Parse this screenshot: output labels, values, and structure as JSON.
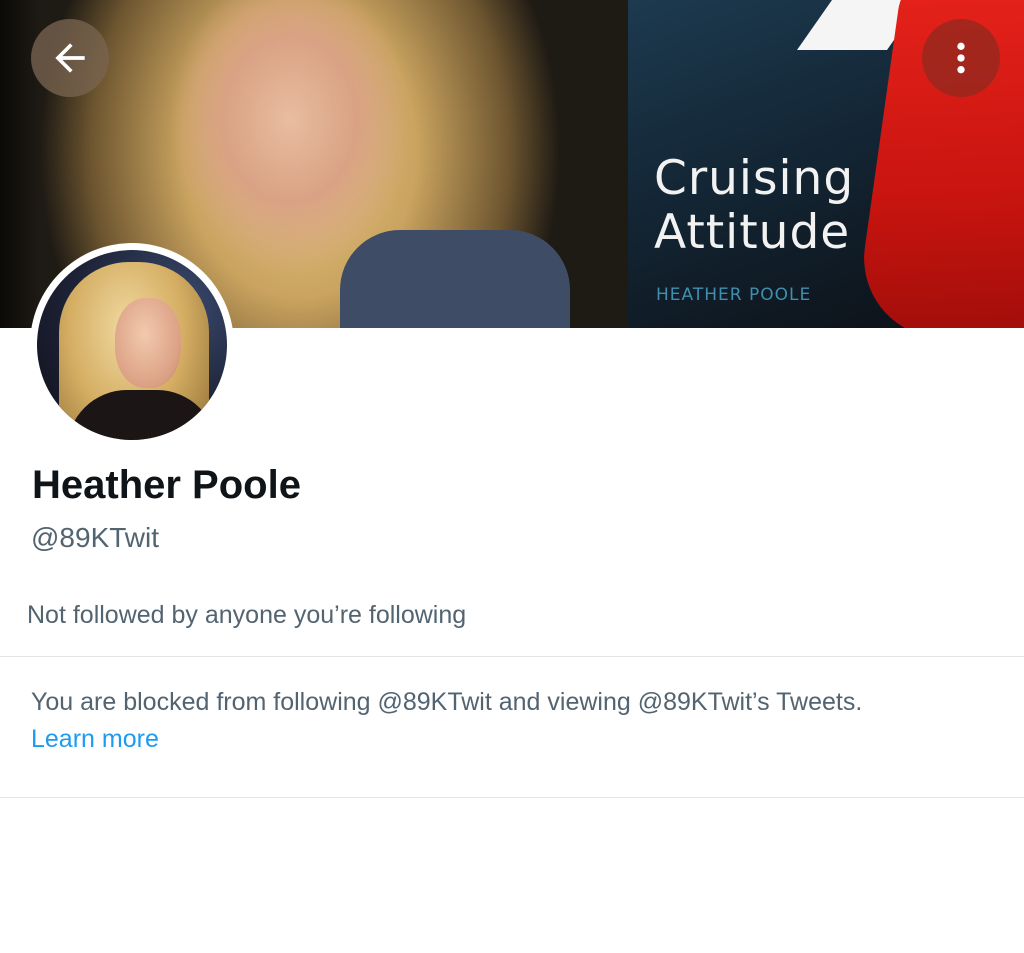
{
  "banner": {
    "book_title": "Cruising\nAttitude",
    "book_author": "HEATHER POOLE"
  },
  "header": {
    "back_icon": "arrow-left-icon",
    "more_icon": "more-vertical-icon"
  },
  "profile": {
    "display_name": "Heather Poole",
    "handle": "@89KTwit",
    "followers_note": "Not followed by anyone you’re following"
  },
  "blocked": {
    "message": "You are blocked from following @89KTwit and viewing @89KTwit’s Tweets.",
    "learn_more_label": "Learn more"
  },
  "colors": {
    "primary_text": "#0f1419",
    "secondary_text": "#536471",
    "link": "#1d9bf0",
    "divider": "#e1e5e8"
  }
}
